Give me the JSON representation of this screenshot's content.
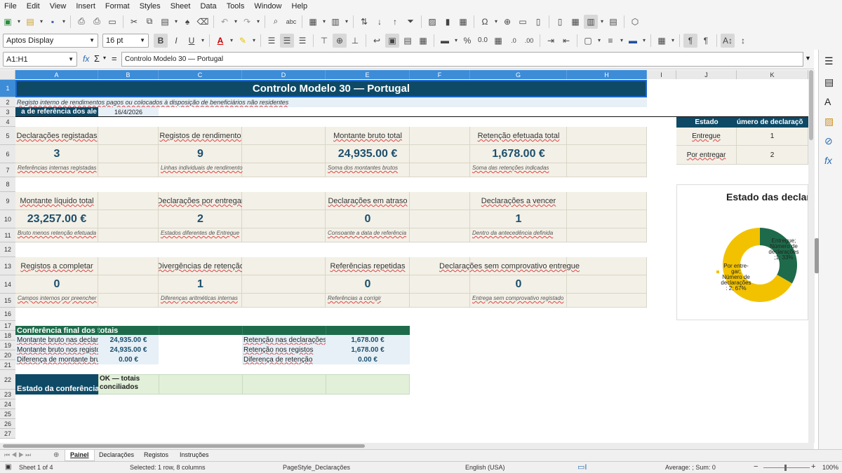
{
  "menu": [
    "File",
    "Edit",
    "View",
    "Insert",
    "Format",
    "Styles",
    "Sheet",
    "Data",
    "Tools",
    "Window",
    "Help"
  ],
  "font_name": "Aptos Display",
  "font_size": "16 pt",
  "name_box": "A1:H1",
  "formula": "Controlo Modelo 30 — Portugal",
  "columns": [
    "A",
    "B",
    "C",
    "D",
    "E",
    "F",
    "G",
    "H",
    "I",
    "J",
    "K"
  ],
  "rows": [
    "1",
    "2",
    "3",
    "4",
    "5",
    "6",
    "7",
    "8",
    "9",
    "10",
    "11",
    "12",
    "13",
    "14",
    "15",
    "16",
    "17",
    "18",
    "19",
    "20",
    "21",
    "22",
    "23",
    "24",
    "25",
    "26",
    "27"
  ],
  "title": "Controlo Modelo 30 — Portugal",
  "subtitle": "Registo interno de rendimentos pagos ou colocados à disposição de beneficiários não residentes",
  "ref_label": "a de referência dos ale",
  "ref_date": "16/4/2026",
  "kpis": [
    {
      "label": "Declarações registadas",
      "value": "3",
      "note": "Referências internas registadas"
    },
    {
      "label": "Registos de rendimento",
      "value": "9",
      "note": "Linhas individuais de rendimento"
    },
    {
      "label": "Montante bruto total",
      "value": "24,935.00 €",
      "note": "Soma dos montantes brutos"
    },
    {
      "label": "Retenção efetuada total",
      "value": "1,678.00 €",
      "note": "Soma das retenções indicadas"
    },
    {
      "label": "Montante líquido total",
      "value": "23,257.00 €",
      "note": "Bruto menos retenção efetuada"
    },
    {
      "label": "Declarações por entregar",
      "value": "2",
      "note": "Estados diferentes de Entregue"
    },
    {
      "label": "Declarações em atraso",
      "value": "0",
      "note": "Consoante a data de referência"
    },
    {
      "label": "Declarações a vencer",
      "value": "1",
      "note": "Dentro da antecedência definida"
    },
    {
      "label": "Registos a completar",
      "value": "0",
      "note": "Campos internos por preencher"
    },
    {
      "label": "Divergências de retenção",
      "value": "1",
      "note": "Diferenças aritméticas internas"
    },
    {
      "label": "Referências repetidas",
      "value": "0",
      "note": "Referências a corrigir"
    },
    {
      "label": "Declarações sem comprovativo entregue",
      "value": "0",
      "note": "Entrega sem comprovativo registado"
    }
  ],
  "conferencia": {
    "header": "Conferência final dos totais",
    "left": [
      {
        "label": "Montante bruto nas declara",
        "value": "24,935.00 €"
      },
      {
        "label": "Montante bruto nos registos",
        "value": "24,935.00 €"
      },
      {
        "label": "Diferença de montante brut",
        "value": "0.00 €"
      }
    ],
    "right": [
      {
        "label": "Retenção nas declarações",
        "value": "1,678.00 €"
      },
      {
        "label": "Retenção nos registos",
        "value": "1,678.00 €"
      },
      {
        "label": "Diferença de retenção",
        "value": "0.00 €"
      }
    ],
    "estado_label": "Estado da conferência",
    "estado_value": "OK — totais conciliados"
  },
  "status_table": {
    "headers": [
      "Estado",
      "úmero de declaraçõ"
    ],
    "rows": [
      {
        "estado": "Entregue",
        "count": "1"
      },
      {
        "estado": "Por entregar",
        "count": "2"
      }
    ]
  },
  "chart_data": {
    "type": "pie",
    "title": "Estado das declara",
    "categories": [
      "Entregue",
      "Por entregar"
    ],
    "values": [
      1,
      2
    ],
    "percent": [
      33,
      67
    ],
    "colors": [
      "#1e6b4b",
      "#f2c200"
    ],
    "data_labels": [
      "Entregue; Número de declarações ; 1; 33%",
      "Por entre-gar; Número de declarações ; 2; 67%"
    ]
  },
  "sheet_tabs": [
    "Painel",
    "Declarações",
    "Registos",
    "Instruções"
  ],
  "active_tab": "Painel",
  "status": {
    "sheet": "Sheet 1 of 4",
    "selection": "Selected: 1 row, 8 columns",
    "page_style": "PageStyle_Declarações",
    "language": "English (USA)",
    "summary": "Average: ; Sum: 0",
    "zoom": "100%"
  }
}
